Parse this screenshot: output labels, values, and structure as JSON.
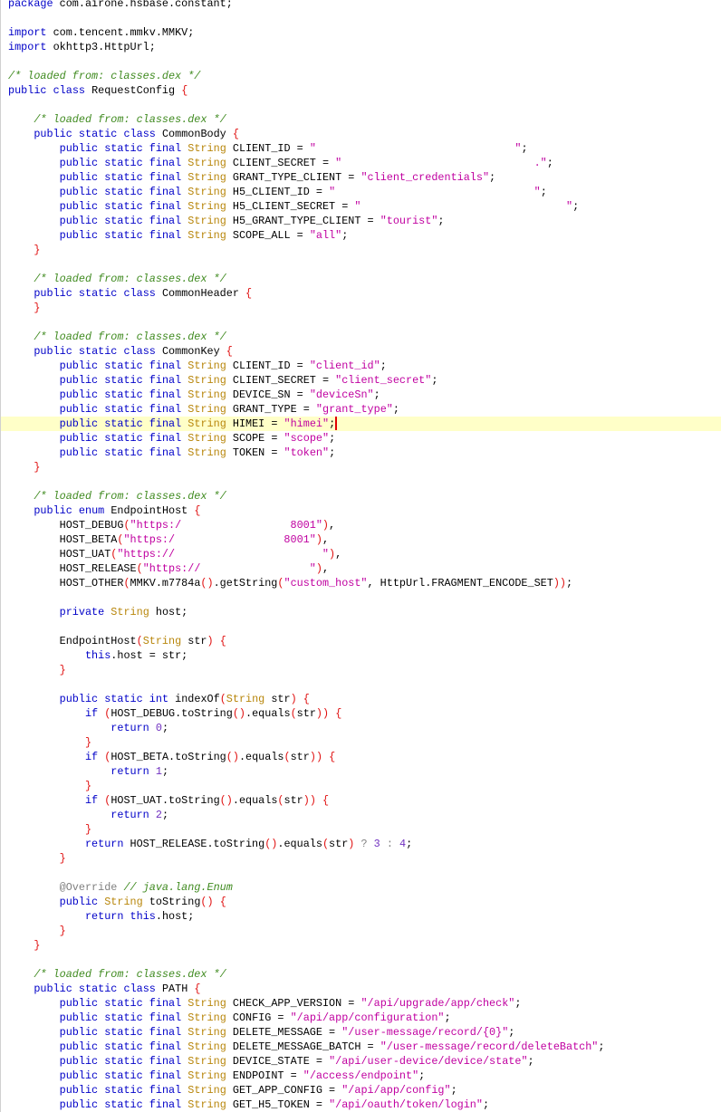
{
  "editor": {
    "highlighted_line": 29,
    "colors": {
      "keyword": "#0000c8",
      "type": "#b8860b",
      "string": "#c000a0",
      "comment": "#3f8a1f",
      "bracket": "#e01010",
      "number": "#7030c0",
      "highlight": "#ffffc8",
      "caret": "#e00000"
    },
    "lines": [
      "package com.airone.hsbase.constant;",
      "",
      "import com.tencent.mmkv.MMKV;",
      "import okhttp3.HttpUrl;",
      "",
      "/* loaded from: classes.dex */",
      "public class RequestConfig {",
      "",
      "    /* loaded from: classes.dex */",
      "    public static class CommonBody {",
      "        public static final String CLIENT_ID = \"                               \";",
      "        public static final String CLIENT_SECRET = \"                              .\";",
      "        public static final String GRANT_TYPE_CLIENT = \"client_credentials\";",
      "        public static final String H5_CLIENT_ID = \"                               \";",
      "        public static final String H5_CLIENT_SECRET = \"                                \";",
      "        public static final String H5_GRANT_TYPE_CLIENT = \"tourist\";",
      "        public static final String SCOPE_ALL = \"all\";",
      "    }",
      "",
      "    /* loaded from: classes.dex */",
      "    public static class CommonHeader {",
      "    }",
      "",
      "    /* loaded from: classes.dex */",
      "    public static class CommonKey {",
      "        public static final String CLIENT_ID = \"client_id\";",
      "        public static final String CLIENT_SECRET = \"client_secret\";",
      "        public static final String DEVICE_SN = \"deviceSn\";",
      "        public static final String GRANT_TYPE = \"grant_type\";",
      "        public static final String HIMEI = \"himei\";",
      "        public static final String SCOPE = \"scope\";",
      "        public static final String TOKEN = \"token\";",
      "    }",
      "",
      "    /* loaded from: classes.dex */",
      "    public enum EndpointHost {",
      "        HOST_DEBUG(\"https:/                 8001\"),",
      "        HOST_BETA(\"https:/                 8001\"),",
      "        HOST_UAT(\"https://                       \"),",
      "        HOST_RELEASE(\"https://                 \"),",
      "        HOST_OTHER(MMKV.m7784a().getString(\"custom_host\", HttpUrl.FRAGMENT_ENCODE_SET));",
      "",
      "        private String host;",
      "",
      "        EndpointHost(String str) {",
      "            this.host = str;",
      "        }",
      "",
      "        public static int indexOf(String str) {",
      "            if (HOST_DEBUG.toString().equals(str)) {",
      "                return 0;",
      "            }",
      "            if (HOST_BETA.toString().equals(str)) {",
      "                return 1;",
      "            }",
      "            if (HOST_UAT.toString().equals(str)) {",
      "                return 2;",
      "            }",
      "            return HOST_RELEASE.toString().equals(str) ? 3 : 4;",
      "        }",
      "",
      "        @Override // java.lang.Enum",
      "        public String toString() {",
      "            return this.host;",
      "        }",
      "    }",
      "",
      "    /* loaded from: classes.dex */",
      "    public static class PATH {",
      "        public static final String CHECK_APP_VERSION = \"/api/upgrade/app/check\";",
      "        public static final String CONFIG = \"/api/app/configuration\";",
      "        public static final String DELETE_MESSAGE = \"/user-message/record/{0}\";",
      "        public static final String DELETE_MESSAGE_BATCH = \"/user-message/record/deleteBatch\";",
      "        public static final String DEVICE_STATE = \"/api/user-device/device/state\";",
      "        public static final String ENDPOINT = \"/access/endpoint\";",
      "        public static final String GET_APP_CONFIG = \"/api/app/config\";",
      "        public static final String GET_H5_TOKEN = \"/api/oauth/token/login\";"
    ]
  }
}
